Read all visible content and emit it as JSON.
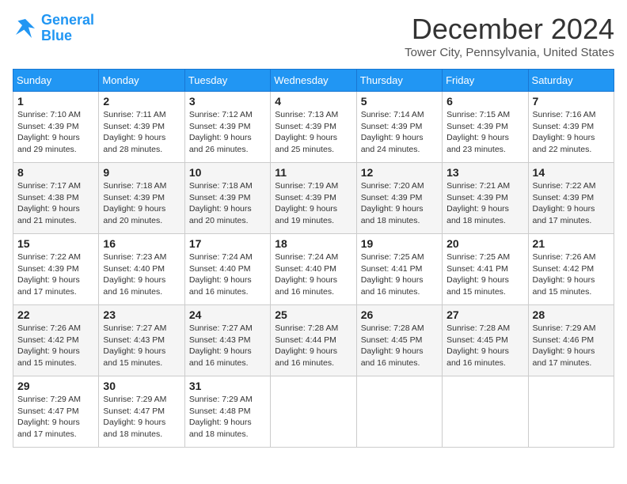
{
  "logo": {
    "line1": "General",
    "line2": "Blue"
  },
  "title": "December 2024",
  "location": "Tower City, Pennsylvania, United States",
  "days_of_week": [
    "Sunday",
    "Monday",
    "Tuesday",
    "Wednesday",
    "Thursday",
    "Friday",
    "Saturday"
  ],
  "weeks": [
    [
      {
        "day": "1",
        "sunrise": "7:10 AM",
        "sunset": "4:39 PM",
        "daylight": "9 hours and 29 minutes."
      },
      {
        "day": "2",
        "sunrise": "7:11 AM",
        "sunset": "4:39 PM",
        "daylight": "9 hours and 28 minutes."
      },
      {
        "day": "3",
        "sunrise": "7:12 AM",
        "sunset": "4:39 PM",
        "daylight": "9 hours and 26 minutes."
      },
      {
        "day": "4",
        "sunrise": "7:13 AM",
        "sunset": "4:39 PM",
        "daylight": "9 hours and 25 minutes."
      },
      {
        "day": "5",
        "sunrise": "7:14 AM",
        "sunset": "4:39 PM",
        "daylight": "9 hours and 24 minutes."
      },
      {
        "day": "6",
        "sunrise": "7:15 AM",
        "sunset": "4:39 PM",
        "daylight": "9 hours and 23 minutes."
      },
      {
        "day": "7",
        "sunrise": "7:16 AM",
        "sunset": "4:39 PM",
        "daylight": "9 hours and 22 minutes."
      }
    ],
    [
      {
        "day": "8",
        "sunrise": "7:17 AM",
        "sunset": "4:38 PM",
        "daylight": "9 hours and 21 minutes."
      },
      {
        "day": "9",
        "sunrise": "7:18 AM",
        "sunset": "4:39 PM",
        "daylight": "9 hours and 20 minutes."
      },
      {
        "day": "10",
        "sunrise": "7:18 AM",
        "sunset": "4:39 PM",
        "daylight": "9 hours and 20 minutes."
      },
      {
        "day": "11",
        "sunrise": "7:19 AM",
        "sunset": "4:39 PM",
        "daylight": "9 hours and 19 minutes."
      },
      {
        "day": "12",
        "sunrise": "7:20 AM",
        "sunset": "4:39 PM",
        "daylight": "9 hours and 18 minutes."
      },
      {
        "day": "13",
        "sunrise": "7:21 AM",
        "sunset": "4:39 PM",
        "daylight": "9 hours and 18 minutes."
      },
      {
        "day": "14",
        "sunrise": "7:22 AM",
        "sunset": "4:39 PM",
        "daylight": "9 hours and 17 minutes."
      }
    ],
    [
      {
        "day": "15",
        "sunrise": "7:22 AM",
        "sunset": "4:39 PM",
        "daylight": "9 hours and 17 minutes."
      },
      {
        "day": "16",
        "sunrise": "7:23 AM",
        "sunset": "4:40 PM",
        "daylight": "9 hours and 16 minutes."
      },
      {
        "day": "17",
        "sunrise": "7:24 AM",
        "sunset": "4:40 PM",
        "daylight": "9 hours and 16 minutes."
      },
      {
        "day": "18",
        "sunrise": "7:24 AM",
        "sunset": "4:40 PM",
        "daylight": "9 hours and 16 minutes."
      },
      {
        "day": "19",
        "sunrise": "7:25 AM",
        "sunset": "4:41 PM",
        "daylight": "9 hours and 16 minutes."
      },
      {
        "day": "20",
        "sunrise": "7:25 AM",
        "sunset": "4:41 PM",
        "daylight": "9 hours and 15 minutes."
      },
      {
        "day": "21",
        "sunrise": "7:26 AM",
        "sunset": "4:42 PM",
        "daylight": "9 hours and 15 minutes."
      }
    ],
    [
      {
        "day": "22",
        "sunrise": "7:26 AM",
        "sunset": "4:42 PM",
        "daylight": "9 hours and 15 minutes."
      },
      {
        "day": "23",
        "sunrise": "7:27 AM",
        "sunset": "4:43 PM",
        "daylight": "9 hours and 15 minutes."
      },
      {
        "day": "24",
        "sunrise": "7:27 AM",
        "sunset": "4:43 PM",
        "daylight": "9 hours and 16 minutes."
      },
      {
        "day": "25",
        "sunrise": "7:28 AM",
        "sunset": "4:44 PM",
        "daylight": "9 hours and 16 minutes."
      },
      {
        "day": "26",
        "sunrise": "7:28 AM",
        "sunset": "4:45 PM",
        "daylight": "9 hours and 16 minutes."
      },
      {
        "day": "27",
        "sunrise": "7:28 AM",
        "sunset": "4:45 PM",
        "daylight": "9 hours and 16 minutes."
      },
      {
        "day": "28",
        "sunrise": "7:29 AM",
        "sunset": "4:46 PM",
        "daylight": "9 hours and 17 minutes."
      }
    ],
    [
      {
        "day": "29",
        "sunrise": "7:29 AM",
        "sunset": "4:47 PM",
        "daylight": "9 hours and 17 minutes."
      },
      {
        "day": "30",
        "sunrise": "7:29 AM",
        "sunset": "4:47 PM",
        "daylight": "9 hours and 18 minutes."
      },
      {
        "day": "31",
        "sunrise": "7:29 AM",
        "sunset": "4:48 PM",
        "daylight": "9 hours and 18 minutes."
      },
      null,
      null,
      null,
      null
    ]
  ],
  "labels": {
    "sunrise": "Sunrise:",
    "sunset": "Sunset:",
    "daylight": "Daylight:"
  }
}
